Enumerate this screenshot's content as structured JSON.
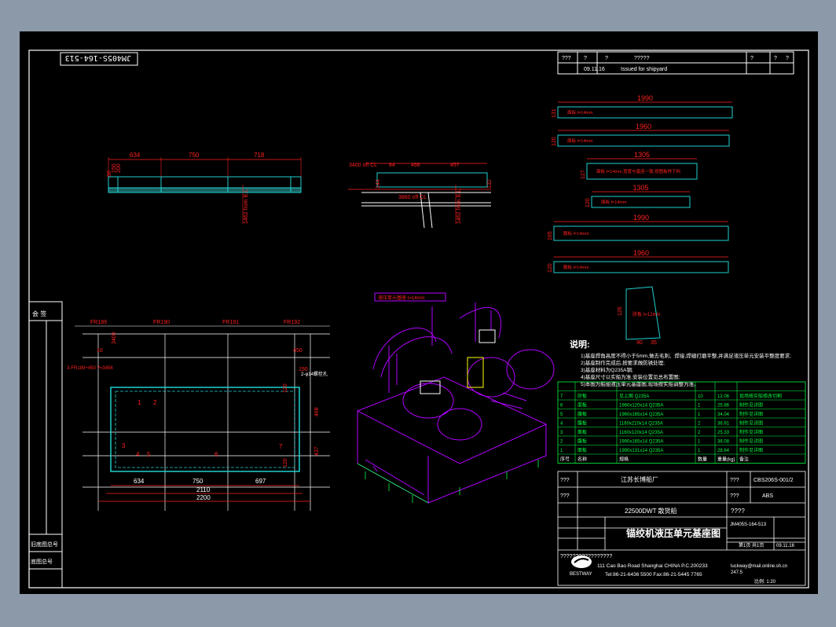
{
  "drawing": {
    "stamp_code": "JM405S-164-513",
    "revision": {
      "header": [
        "???",
        "?",
        "?",
        "?????",
        "?",
        "?",
        "?"
      ],
      "row": [
        "09.11.16",
        "Issued for shipyard"
      ]
    },
    "left_stamps": [
      "会 签",
      "旧底图总号",
      "底图总号"
    ],
    "scale": "比例: 1:20"
  },
  "view1": {
    "dims": [
      "634",
      "750",
      "718"
    ],
    "side_dims": [
      "50",
      "150",
      "200"
    ],
    "vertical_note": "1462 from B.L."
  },
  "view2": {
    "dims": [
      "3400 off CL",
      "84",
      "468",
      "457"
    ],
    "vertical": [
      "144",
      "132"
    ],
    "note_off": "3860 off CL",
    "vertical_note": "1462 from B.L."
  },
  "plates": [
    {
      "length": "1990",
      "height": "131",
      "label": "面板 t=14mm"
    },
    {
      "length": "1960",
      "height": "120",
      "label": "面板 t=14mm"
    },
    {
      "length": "1305",
      "height": "127",
      "label": "面板 t=14mm,宽度与基座一致,按图板样下料"
    },
    {
      "length": "1305",
      "height": "120",
      "label": "面板 t=14mm"
    },
    {
      "length": "1990",
      "height": "165",
      "label": "腹板 t=14mm"
    },
    {
      "length": "1960",
      "height": "120",
      "label": "腹板 t=14mm"
    }
  ],
  "bracket": {
    "dims": [
      "126",
      "90",
      "35"
    ],
    "label": "肘板 t=12mm"
  },
  "plan_view": {
    "frames": [
      "FR189",
      "FR190",
      "FR191",
      "FR192"
    ],
    "top_dims": [
      "3400",
      "10",
      "450",
      "150"
    ],
    "bottom_dims": [
      "634",
      "750",
      "697"
    ],
    "total_inner": "2110",
    "total_outer": "2200",
    "right_dims": [
      "120",
      "468",
      "437",
      "120"
    ],
    "left_note": "3-FR189+450 ?=3456",
    "note_right": "2-φ14螺栓孔",
    "markers": [
      "1",
      "2",
      "3",
      "4",
      "5",
      "6",
      "7"
    ]
  },
  "iso_label": "液压单元基座 t=14mm",
  "notes": {
    "title": "说明:",
    "lines": [
      "1)基座焊角高度不得小于5mm,做去毛刺、焊接,焊缝打磨平整,并满足液压单元安装平整度要求;",
      "2)基座制作完成后,按要求做防锈处理;",
      "3)基座材料为Q235A钢;",
      "4)基座尺寸以实船为准,安装位置见总布置图;",
      "5)本图为船舶液压单元基座图,现场按实船调整为准。"
    ]
  },
  "parts_table": {
    "headers": [
      "序号",
      "名称",
      "规格",
      "数量",
      "重量(kg)",
      "备注"
    ],
    "rows": [
      [
        "7",
        "肘板",
        "见上图 Q235A",
        "10",
        "12.06",
        "现场按实船修改切割"
      ],
      [
        "6",
        "面板",
        "1960x120x14 Q235A",
        "1",
        "25.86",
        "制作见详图"
      ],
      [
        "5",
        "腹板",
        "1960x165x14 Q235A",
        "1",
        "34.04",
        "制作见详图"
      ],
      [
        "4",
        "腹板",
        "1160x210x14 Q235A",
        "2",
        "36.91",
        "制作见详图"
      ],
      [
        "3",
        "面板",
        "1160x120x14 Q235A",
        "2",
        "25.33",
        "制作见详图"
      ],
      [
        "2",
        "腹板",
        "1990x165x14 Q235A",
        "1",
        "36.08",
        "制作见详图"
      ],
      [
        "1",
        "面板",
        "1990x131x14 Q235A",
        "1",
        "28.64",
        "制作见详图"
      ]
    ]
  },
  "title_block": {
    "company": "江苏长博船厂",
    "project_code": "CBS206S-001/2",
    "class": "ABS",
    "ship": "22500DWT 散货船",
    "drawing_no": "JM405S-164-513",
    "title": "锚绞机液压单元基座图",
    "date": "09.11.16",
    "sheet": "第1页 共1页",
    "marks": [
      "???",
      "???",
      "???",
      "???",
      "????",
      "????",
      "?????????????????"
    ],
    "address": "111 Cao Bao Road Shanghai CHINA   P.C.200233",
    "phone": "Tel:86-21-6436 5500  Fax:86-21-5445 7765",
    "email": "luckway@mail.online.sh.cn",
    "logo_text": "BESTWAY",
    "weight": "247.5"
  },
  "colors": {
    "frame": "#ffffff",
    "dim": "#ff2020",
    "part": "#20d0d0",
    "iso": "#b000ff",
    "fill_hatch": "#00ff40",
    "yellow": "#ffff00"
  }
}
